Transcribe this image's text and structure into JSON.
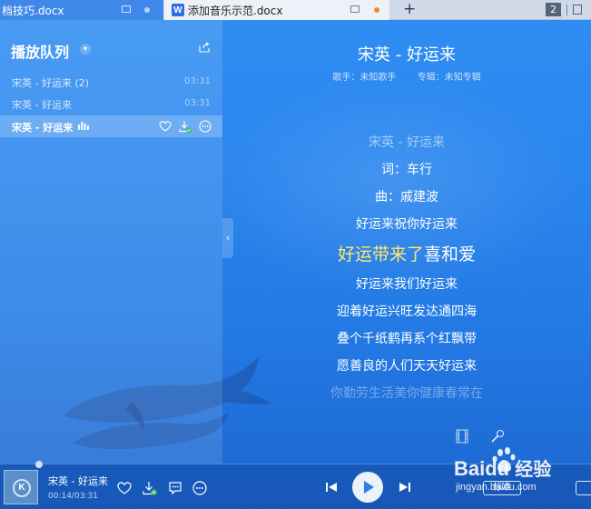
{
  "tabs": [
    {
      "label": "档技巧.docx"
    },
    {
      "label": "添加音乐示范.docx",
      "doc_icon": "W"
    }
  ],
  "tab_count": "2",
  "tab_add": "+",
  "queue": {
    "title": "播放队列",
    "items": [
      {
        "name": "宋英 - 好运来 (2)",
        "time": "03:31"
      },
      {
        "name": "宋英 - 好运来",
        "time": "03:31"
      },
      {
        "name": "宋英 - 好运来",
        "time": ""
      }
    ]
  },
  "song": {
    "title": "宋英 - 好运来",
    "singer": "歌手：未知歌手",
    "album": "专辑：未知专辑"
  },
  "lyrics": {
    "before": [
      "宋英 - 好运来",
      "词：车行",
      "曲：戚建波",
      "好运来祝你好运来"
    ],
    "current_sung": "好运带来了",
    "current_rest": "喜和爱",
    "after": [
      "好运来我们好运来",
      "迎着好运兴旺发达通四海",
      "叠个千纸鹤再系个红飘带",
      "愿善良的人们天天好运来",
      "你勤劳生活美你健康春常在"
    ]
  },
  "now_playing": {
    "title": "宋英 - 好运来",
    "time": "00:14/03:31",
    "album_letter": "K"
  },
  "progress": 0.066,
  "quality_label": "标准",
  "watermark": {
    "brand": "Baidu",
    "cn": "经验",
    "url": "jingyan.baidu.com"
  },
  "colors": {
    "highlight": "#ffe86b",
    "tab_active": "#3f88e9",
    "dot": "#f08a24"
  }
}
